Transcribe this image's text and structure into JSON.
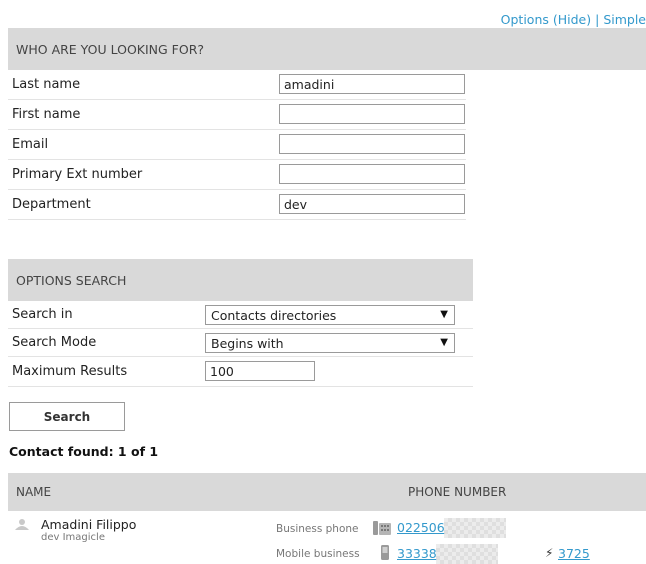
{
  "top_links": {
    "options": "Options (Hide)",
    "separator": "|",
    "simple": "Simple"
  },
  "who_section": {
    "title": "WHO ARE YOU LOOKING FOR?",
    "fields": [
      {
        "label": "Last name",
        "value": "amadini"
      },
      {
        "label": "First name",
        "value": ""
      },
      {
        "label": "Email",
        "value": ""
      },
      {
        "label": "Primary Ext number",
        "value": ""
      },
      {
        "label": "Department",
        "value": "dev"
      }
    ]
  },
  "options_section": {
    "title": "OPTIONS SEARCH",
    "search_in": {
      "label": "Search in",
      "value": "Contacts directories"
    },
    "search_mode": {
      "label": "Search Mode",
      "value": "Begins with"
    },
    "max_results": {
      "label": "Maximum Results",
      "value": "100"
    }
  },
  "search_button": "Search",
  "contact_found": "Contact found: 1 of 1",
  "results": {
    "header_name": "NAME",
    "header_phone": "PHONE NUMBER",
    "contact": {
      "name": "Amadini Filippo",
      "department": "dev Imagicle",
      "business_label": "Business phone",
      "business_number": "022506",
      "mobile_label": "Mobile business",
      "mobile_number": "33338",
      "extension_icon": "bolt-icon",
      "extension": "3725"
    }
  },
  "colors": {
    "link": "#3399cc",
    "header_bg": "#d9d9d9"
  }
}
